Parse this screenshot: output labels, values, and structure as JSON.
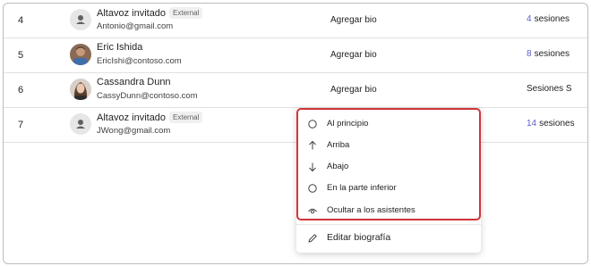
{
  "rows": [
    {
      "num": "4",
      "name": "Altavoz invitado",
      "badge": "External",
      "email": "Antonio@gmail.com",
      "bio": "Agregar bio",
      "session_count": "4",
      "session_label": "sesiones"
    },
    {
      "num": "5",
      "name": "Eric Ishida",
      "email": "EricIshi@contoso.com",
      "bio": "Agregar bio",
      "session_count": "8",
      "session_label": "sesiones"
    },
    {
      "num": "6",
      "name": "Cassandra Dunn",
      "email": "CassyDunn@contoso.com",
      "bio": "Agregar bio",
      "session_label": "Sesiones S"
    },
    {
      "num": "7",
      "name": "Altavoz invitado",
      "badge": "External",
      "email": "JWong@gmail.com",
      "session_count": "14",
      "session_label": "sesiones"
    }
  ],
  "context_menu": {
    "items": [
      {
        "label": "Al principio",
        "icon": "circle-icon"
      },
      {
        "label": "Arriba",
        "icon": "arrow-up-icon"
      },
      {
        "label": "Abajo",
        "icon": "arrow-down-icon"
      },
      {
        "label": "En la parte inferior",
        "icon": "circle-icon"
      },
      {
        "label": "Ocultar a los asistentes",
        "icon": "eye-icon"
      }
    ],
    "edit_item": {
      "label": "Editar biografía",
      "icon": "pencil-icon"
    }
  },
  "colors": {
    "accent": "#5b5fc7",
    "highlight_border": "#d13438"
  }
}
